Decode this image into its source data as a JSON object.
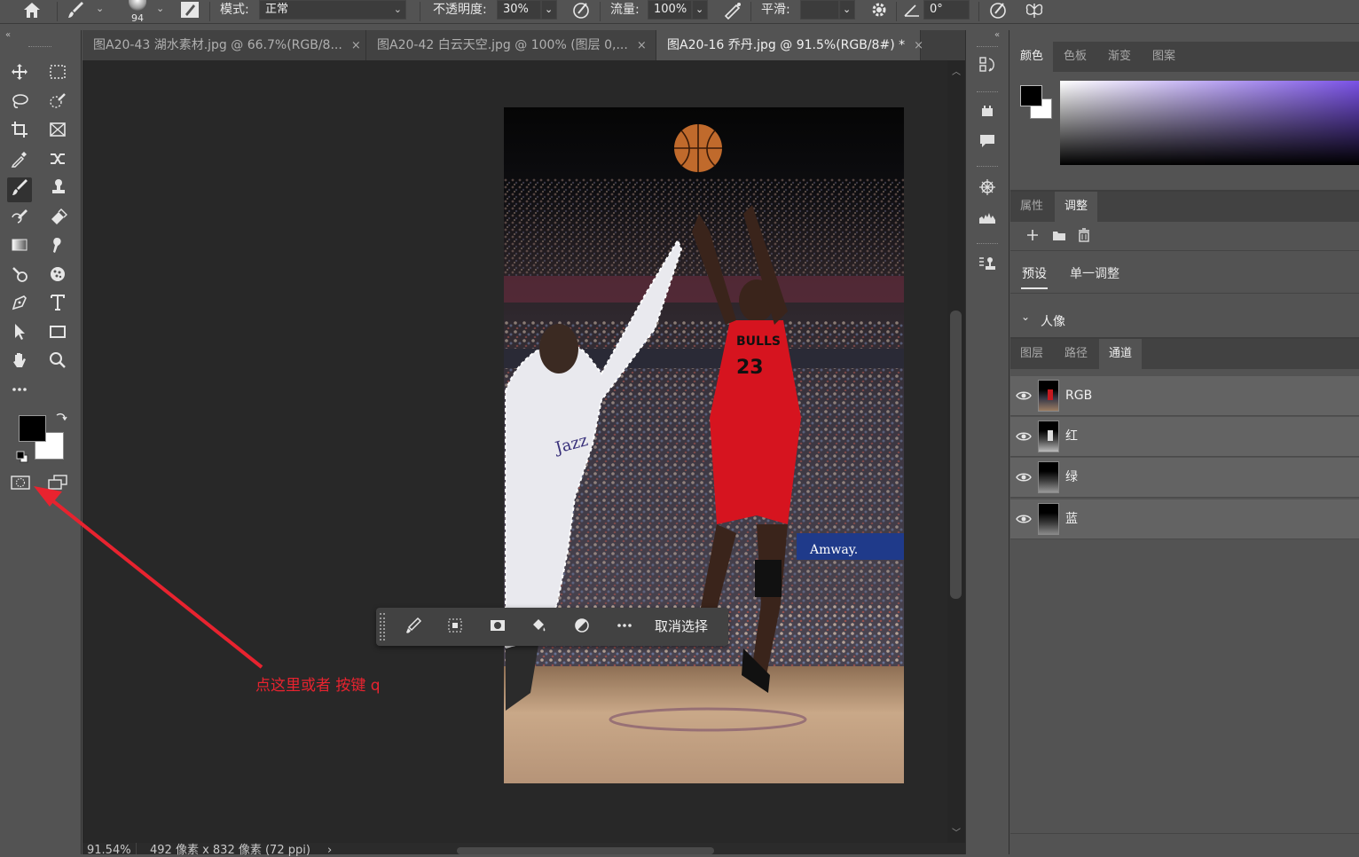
{
  "options_bar": {
    "brush_size": "94",
    "mode_label": "模式:",
    "mode_value": "正常",
    "opacity_label": "不透明度:",
    "opacity_value": "30%",
    "flow_label": "流量:",
    "flow_value": "100%",
    "smoothing_label": "平滑:",
    "smoothing_value": "",
    "angle_value": "0°"
  },
  "tabs": [
    {
      "label": "图A20-43 湖水素材.jpg @ 66.7%(RGB/8...",
      "close": "×"
    },
    {
      "label": "图A20-42 白云天空.jpg @ 100% (图层 0,...",
      "close": "×"
    },
    {
      "label": "图A20-16 乔丹.jpg @ 91.5%(RGB/8#) *",
      "close": "×"
    }
  ],
  "context_bar": {
    "deselect_label": "取消选择"
  },
  "annotation": {
    "text": "点这里或者 按键 q",
    "color": "#e8232f"
  },
  "status_bar": {
    "zoom": "91.54%",
    "doc_info": "492 像素 x 832 像素 (72 ppi)",
    "arrow": "›"
  },
  "panels": {
    "color_tabs": [
      "颜色",
      "色板",
      "渐变",
      "图案"
    ],
    "adjust_tabs": [
      "属性",
      "调整"
    ],
    "adjust_subtabs": [
      "预设",
      "单一调整"
    ],
    "adjust_group": "人像",
    "layer_tabs": [
      "图层",
      "路径",
      "通道"
    ],
    "channels": [
      {
        "name": "RGB"
      },
      {
        "name": "红"
      },
      {
        "name": "绿"
      },
      {
        "name": "蓝"
      }
    ]
  },
  "colors": {
    "foreground": "#000000",
    "background": "#ffffff",
    "accent_red": "#e8232f"
  }
}
